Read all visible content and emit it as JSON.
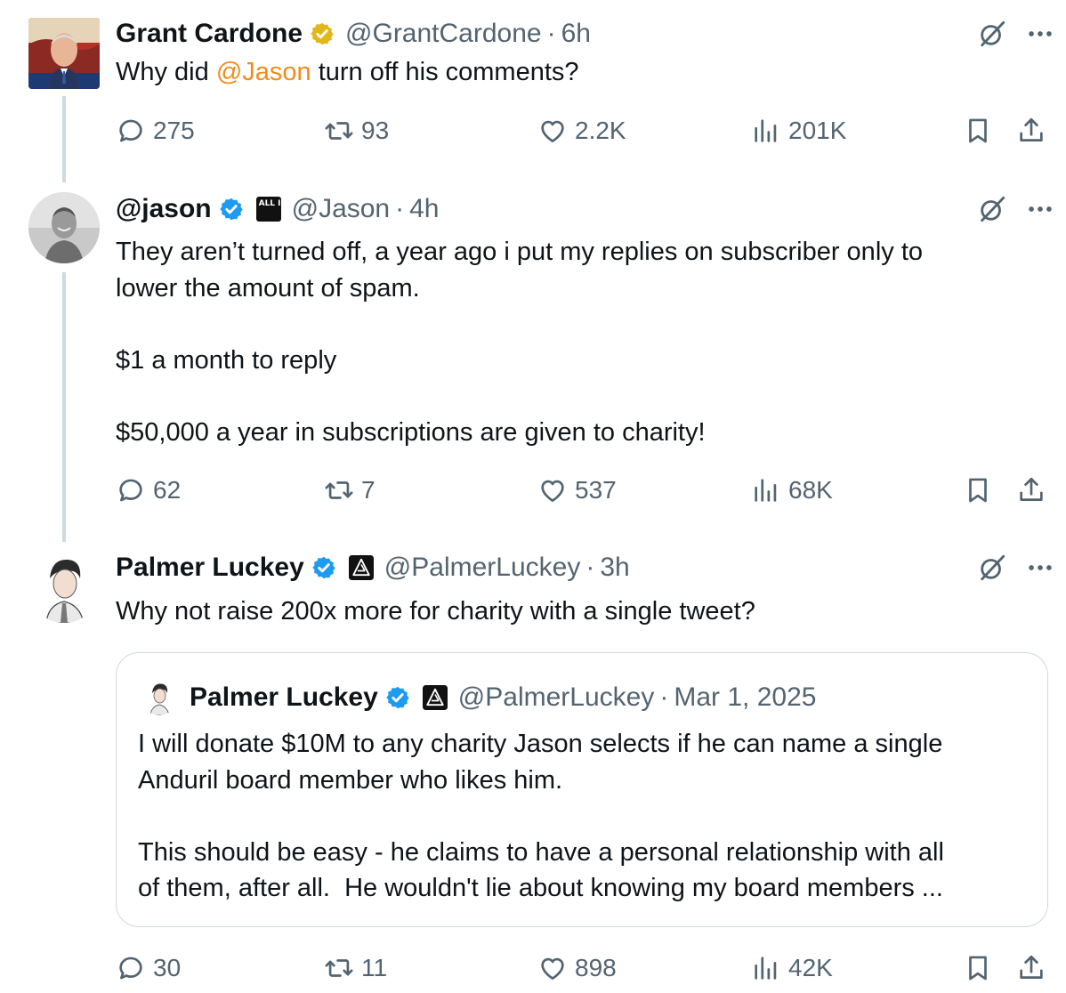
{
  "tweets": [
    {
      "name": "Grant Cardone",
      "badge": "gold-verified",
      "handle": "@GrantCardone",
      "time": "6h",
      "text_prefix": "Why did ",
      "mention": "@Jason",
      "text_suffix": " turn off his comments?",
      "replies": "275",
      "retweets": "93",
      "likes": "2.2K",
      "views": "201K"
    },
    {
      "name": "@jason",
      "badge": "blue-verified",
      "affiliate": "ALL IN",
      "handle": "@Jason",
      "time": "4h",
      "text": "They aren’t turned off, a year ago i put my replies on subscriber only to\nlower the amount of spam.\n\n$1 a month to reply\n\n$50,000 a year in subscriptions are given to charity!",
      "replies": "62",
      "retweets": "7",
      "likes": "537",
      "views": "68K"
    },
    {
      "name": "Palmer Luckey",
      "badge": "blue-verified",
      "handle": "@PalmerLuckey",
      "time": "3h",
      "text": "Why not raise 200x more for charity with a single tweet?",
      "replies": "30",
      "retweets": "11",
      "likes": "898",
      "views": "42K",
      "quote": {
        "name": "Palmer Luckey",
        "handle": "@PalmerLuckey",
        "time": "Mar 1, 2025",
        "text": "I will donate $10M to any charity Jason selects if he can name a single\nAnduril board member who likes him.\n\nThis should be easy - he claims to have a personal relationship with all\nof them, after all.  He wouldn't lie about knowing my board members ..."
      }
    }
  ],
  "separator": "·",
  "colors": {
    "text": "#0f1419",
    "secondary": "#536471",
    "blue_badge": "#1d9bf0",
    "gold_badge": "#e2b719",
    "mention": "#f28b1b",
    "border": "#cfd9de"
  },
  "icons": [
    "grok-icon",
    "more-icon",
    "reply-icon",
    "retweet-icon",
    "like-icon",
    "views-icon",
    "bookmark-icon",
    "share-icon"
  ]
}
